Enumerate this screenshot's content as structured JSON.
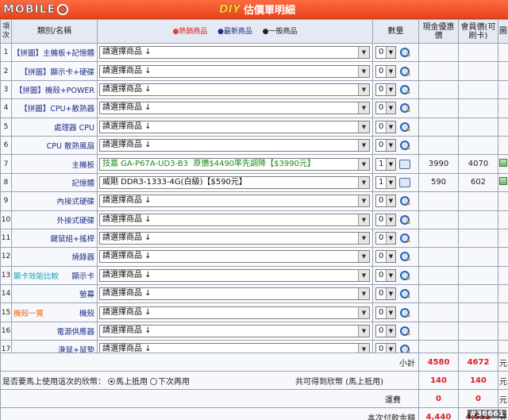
{
  "header": {
    "logo": "MOBILE",
    "diy": "DIY",
    "title": "估價單明細"
  },
  "columns": {
    "no": "項次",
    "category": "類別/名稱",
    "legend": [
      "熱銷商品",
      "最新商品",
      "一般商品"
    ],
    "qty": "數量",
    "cash_price": "現金優惠價",
    "member_price": "會員價(可刷卡)",
    "pic": "圖"
  },
  "rows": [
    {
      "no": "1",
      "category": "【拼圖】主機板+記憶體",
      "product": "請選擇商品 ↓",
      "qty": "0",
      "cash": "",
      "member": ""
    },
    {
      "no": "2",
      "category": "【拼圖】顯示卡+硬碟",
      "product": "請選擇商品 ↓",
      "qty": "0",
      "cash": "",
      "member": ""
    },
    {
      "no": "3",
      "category": "【拼圖】機殼+POWER",
      "product": "請選擇商品 ↓",
      "qty": "0",
      "cash": "",
      "member": ""
    },
    {
      "no": "4",
      "category": "【拼圖】CPU+散熱器",
      "product": "請選擇商品 ↓",
      "qty": "0",
      "cash": "",
      "member": ""
    },
    {
      "no": "5",
      "category": "處理器 CPU",
      "product": "請選擇商品 ↓",
      "qty": "0",
      "cash": "",
      "member": ""
    },
    {
      "no": "6",
      "category": "CPU 散熱風扇",
      "product": "請選擇商品 ↓",
      "qty": "0",
      "cash": "",
      "member": ""
    },
    {
      "no": "7",
      "category": "主機板",
      "product": "技嘉 GA-P67A-UD3-B3",
      "product_note": "原價$4490率先調降【$3990元】",
      "qty": "1",
      "cash": "3990",
      "member": "4070"
    },
    {
      "no": "8",
      "category": "記憶體",
      "product": "威剛 DDR3-1333-4G(白級)【$590元】",
      "qty": "1",
      "cash": "590",
      "member": "602"
    },
    {
      "no": "9",
      "category": "內接式硬碟",
      "product": "請選擇商品 ↓",
      "qty": "0",
      "cash": "",
      "member": ""
    },
    {
      "no": "10",
      "category": "外接式硬碟",
      "product": "請選擇商品 ↓",
      "qty": "0",
      "cash": "",
      "member": ""
    },
    {
      "no": "11",
      "category": "鍵鼠組+搖桿",
      "product": "請選擇商品 ↓",
      "qty": "0",
      "cash": "",
      "member": ""
    },
    {
      "no": "12",
      "category": "燒錄器",
      "product": "請選擇商品 ↓",
      "qty": "0",
      "cash": "",
      "member": ""
    },
    {
      "no": "13",
      "category": "顯示卡",
      "category_link": "顯卡效能比較",
      "product": "請選擇商品 ↓",
      "qty": "0",
      "cash": "",
      "member": ""
    },
    {
      "no": "14",
      "category": "螢幕",
      "product": "請選擇商品 ↓",
      "qty": "0",
      "cash": "",
      "member": ""
    },
    {
      "no": "15",
      "category": "機殼",
      "category_link": "機殼一覽",
      "product": "請選擇商品 ↓",
      "qty": "0",
      "cash": "",
      "member": ""
    },
    {
      "no": "16",
      "category": "電源供應器",
      "product": "請選擇商品 ↓",
      "qty": "0",
      "cash": "",
      "member": ""
    },
    {
      "no": "17",
      "category": "滑鼠+鼠墊",
      "product": "請選擇商品 ↓",
      "qty": "0",
      "cash": "",
      "member": ""
    }
  ],
  "summary": {
    "subtotal_label": "小計",
    "subtotal_cash": "4580",
    "subtotal_member": "4672",
    "yuan": "元",
    "coin_question": "是否要馬上使用這次的欣幣：",
    "radio_now": "馬上抵用",
    "radio_later": "下次再用",
    "coin_label": "共可得到欣幣 (馬上抵用)",
    "coin_cash": "140",
    "coin_member": "140",
    "shipping_label": "運費",
    "shipping_cash": "0",
    "shipping_member": "0",
    "total_label": "本次付款金額",
    "total_cash": "4,440",
    "total_member": "4,532"
  },
  "watermark": "#36661"
}
